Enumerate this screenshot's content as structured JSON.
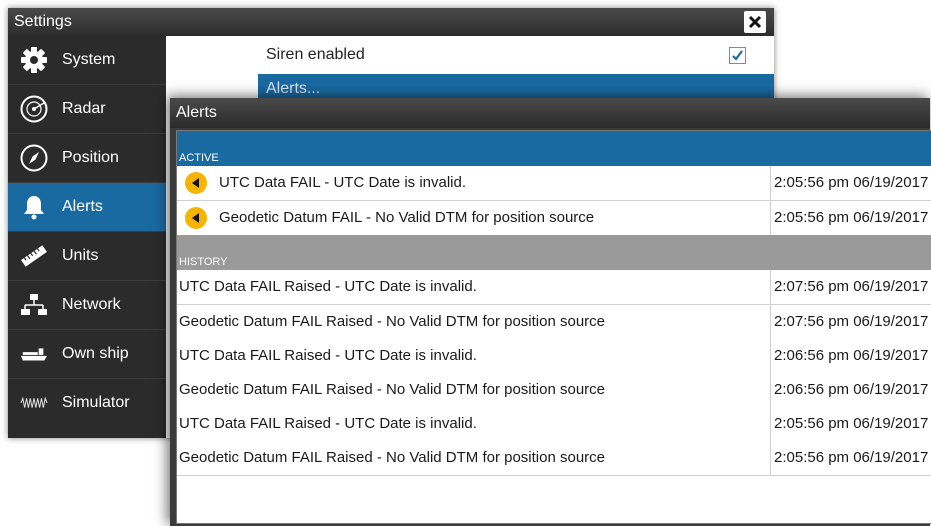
{
  "settings": {
    "title": "Settings",
    "sidebar": [
      {
        "label": "System",
        "icon": "gear-icon",
        "selected": false
      },
      {
        "label": "Radar",
        "icon": "radar-icon",
        "selected": false
      },
      {
        "label": "Position",
        "icon": "compass-icon",
        "selected": false
      },
      {
        "label": "Alerts",
        "icon": "bell-icon",
        "selected": true
      },
      {
        "label": "Units",
        "icon": "ruler-icon",
        "selected": false
      },
      {
        "label": "Network",
        "icon": "network-icon",
        "selected": false
      },
      {
        "label": "Own ship",
        "icon": "ship-icon",
        "selected": false
      },
      {
        "label": "Simulator",
        "icon": "waveform-icon",
        "selected": false
      }
    ],
    "siren_label": "Siren enabled",
    "siren_checked": true,
    "alerts_item_label": "Alerts..."
  },
  "alerts_window": {
    "title": "Alerts",
    "active_header": "ACTIVE",
    "history_header": "HISTORY",
    "active": [
      {
        "message": "UTC Data FAIL - UTC Date is invalid.",
        "time": "2:05:56 pm 06/19/2017"
      },
      {
        "message": "Geodetic Datum FAIL - No Valid DTM for position source",
        "time": "2:05:56 pm 06/19/2017"
      }
    ],
    "history": [
      {
        "message": "UTC Data FAIL Raised - UTC Date is invalid.",
        "time": "2:07:56 pm 06/19/2017"
      },
      {
        "message": "Geodetic Datum FAIL Raised - No Valid DTM for position source",
        "time": "2:07:56 pm 06/19/2017"
      },
      {
        "message": "UTC Data FAIL Raised - UTC Date is invalid.",
        "time": "2:06:56 pm 06/19/2017"
      },
      {
        "message": "Geodetic Datum FAIL Raised - No Valid DTM for position source",
        "time": "2:06:56 pm 06/19/2017"
      },
      {
        "message": "UTC Data FAIL Raised - UTC Date is invalid.",
        "time": "2:05:56 pm 06/19/2017"
      },
      {
        "message": "Geodetic Datum FAIL Raised - No Valid DTM for position source",
        "time": "2:05:56 pm 06/19/2017"
      }
    ]
  },
  "colors": {
    "accent": "#1a6aa2",
    "alarm": "#f4b400",
    "history_header": "#9a9a9a",
    "window_dark": "#2b2b2b"
  }
}
